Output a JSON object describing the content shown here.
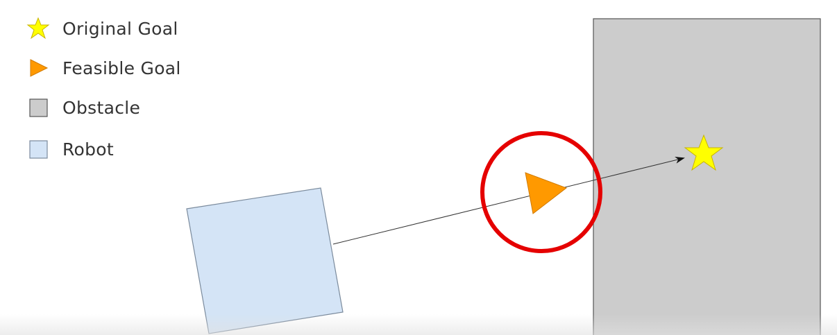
{
  "legend": {
    "items": [
      {
        "label": "Original Goal",
        "icon": "star-icon"
      },
      {
        "label": "Feasible Goal",
        "icon": "triangle-icon"
      },
      {
        "label": "Obstacle",
        "icon": "gray-square-icon"
      },
      {
        "label": "Robot",
        "icon": "blue-square-icon"
      }
    ]
  },
  "colors": {
    "star_fill": "#ffff00",
    "star_stroke": "#c8b400",
    "triangle_fill": "#ff9900",
    "triangle_stroke": "#d07a00",
    "obstacle_fill": "#cccccc",
    "obstacle_stroke": "#555555",
    "robot_fill": "#d4e4f6",
    "robot_stroke": "#7a8a9c",
    "highlight_circle": "#e50000",
    "line": "#333333"
  }
}
